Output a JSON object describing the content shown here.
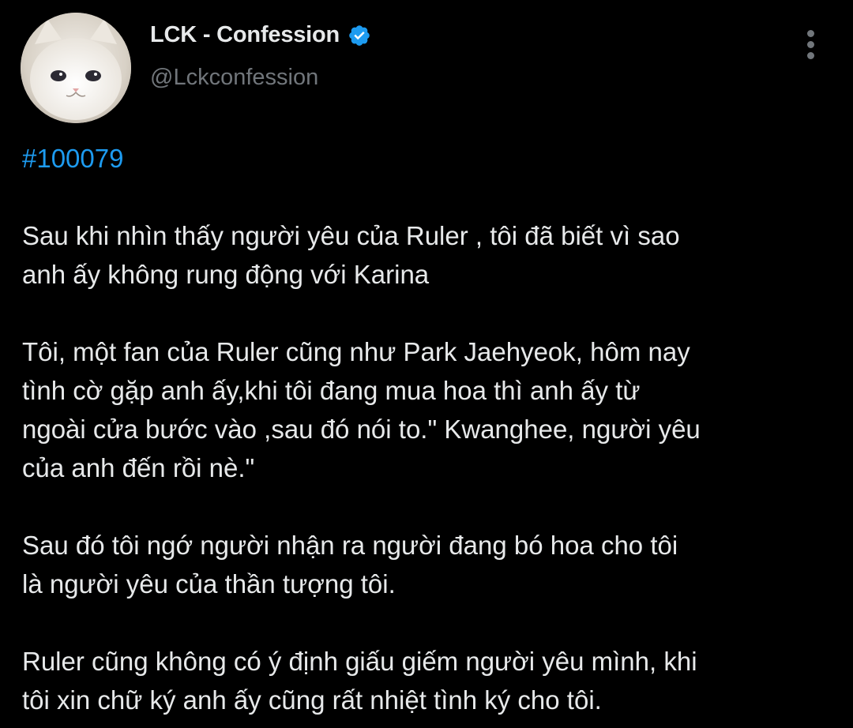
{
  "author": {
    "display_name": "LCK - Confession",
    "handle": "@Lckconfession",
    "verified": true,
    "avatar_icon": "white-cat-avatar"
  },
  "icons": {
    "verified": "verified-badge-icon",
    "more": "more-options-icon"
  },
  "colors": {
    "background": "#000000",
    "text": "#e7e9ea",
    "secondary": "#71767b",
    "accent": "#1d9bf0"
  },
  "tweet": {
    "hashtag": "#100079",
    "paragraphs": [
      "Sau khi nhìn thấy người yêu của Ruler , tôi đã biết vì sao\nanh ấy không rung động với Karina",
      "Tôi, một fan của Ruler cũng như Park Jaehyeok, hôm nay\ntình cờ gặp anh ấy,khi tôi đang mua hoa thì anh ấy từ\nngoài cửa bước vào ,sau đó nói to.\" Kwanghee, người yêu\ncủa anh đến rồi nè.\"",
      "Sau đó tôi ngớ người nhận ra người đang bó hoa cho tôi\nlà người yêu của thần tượng tôi.",
      "Ruler cũng không có ý định giấu giếm người yêu mình, khi\ntôi xin chữ ký anh ấy cũng rất nhiệt tình ký cho tôi."
    ]
  }
}
